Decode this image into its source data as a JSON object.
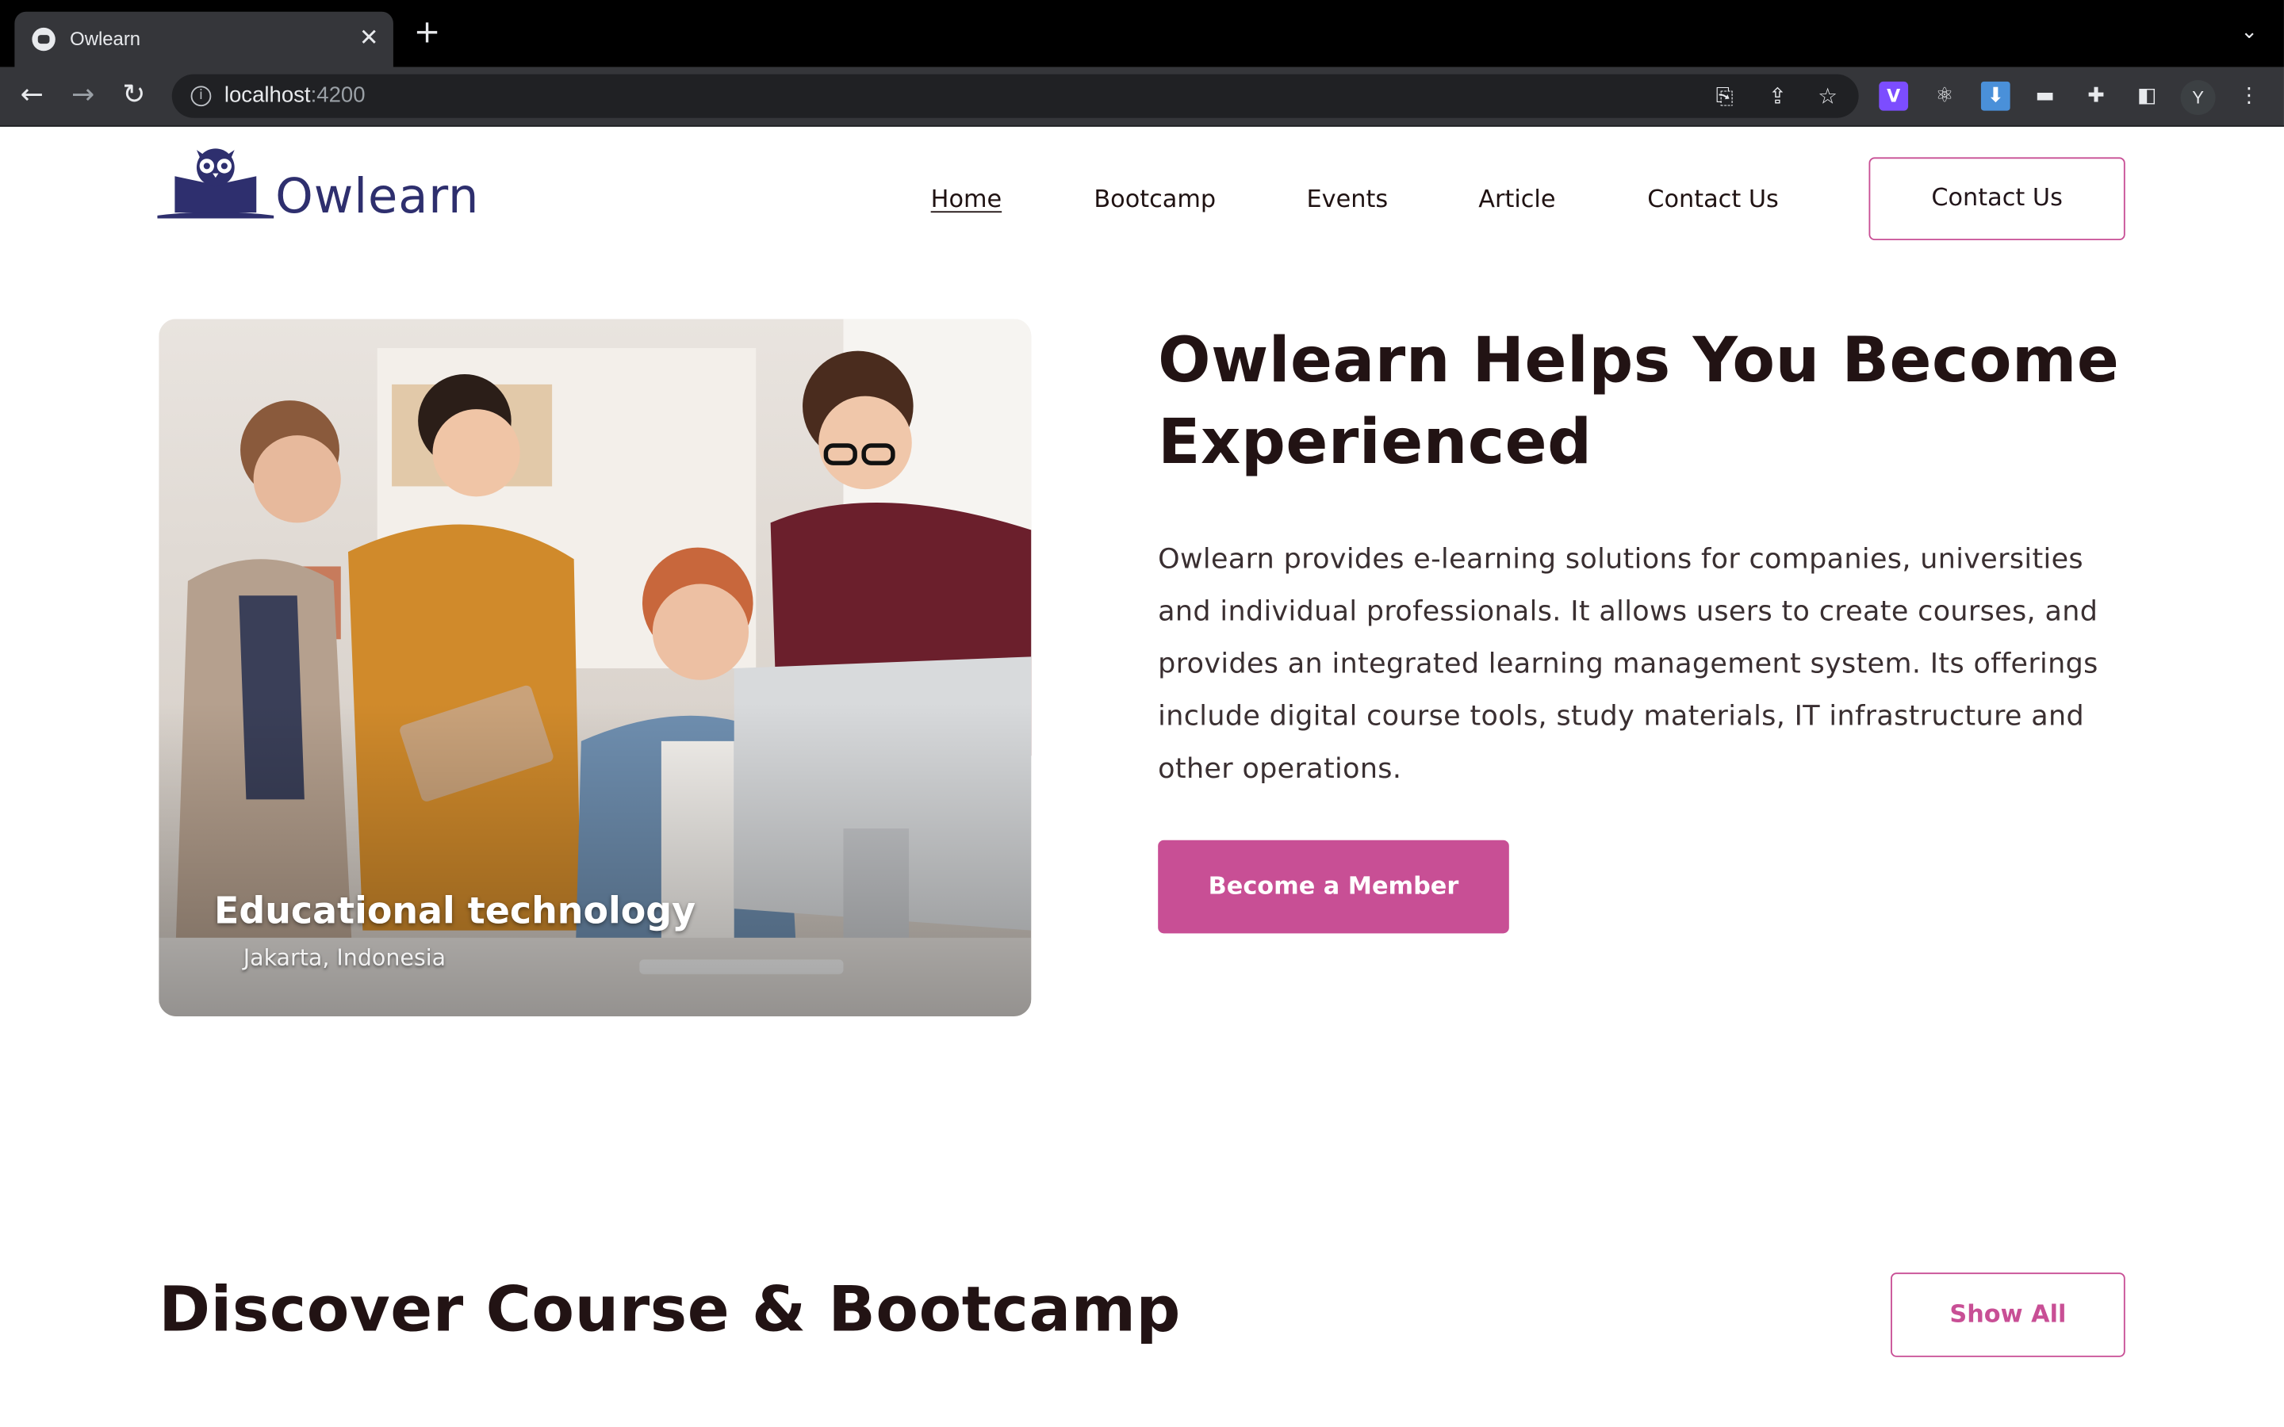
{
  "browser": {
    "tab_title": "Owlearn",
    "tab_close": "✕",
    "new_tab": "+",
    "tab_menu": "⌄",
    "url_host": "localhost",
    "url_port": ":4200",
    "info_icon_glyph": "i",
    "profile_initial": "Y",
    "icons": [
      "back-icon",
      "forward-icon",
      "reload-icon",
      "translate-icon",
      "share-icon",
      "bookmark-star-icon",
      "extension-v-icon",
      "react-devtools-icon",
      "download-icon",
      "extension-icon",
      "puzzle-icon",
      "side-panel-icon",
      "menu-dots-icon"
    ]
  },
  "site": {
    "logo_text": "Owlearn",
    "nav": {
      "home": "Home",
      "bootcamp": "Bootcamp",
      "events": "Events",
      "article": "Article",
      "contact": "Contact Us"
    },
    "cta_contact": "Contact Us"
  },
  "hero": {
    "image_caption": "Educational technology",
    "image_location": "Jakarta, Indonesia",
    "title": "Owlearn Helps You Become Experienced",
    "description": "Owlearn provides e-learning solutions for companies, universities and individual professionals. It allows users to create courses, and provides an integrated learning management system. Its offerings include digital course tools, study materials, IT infrastructure and other operations.",
    "button": "Become a Member"
  },
  "courses": {
    "title": "Discover Course & Bootcamp",
    "show_all": "Show All"
  },
  "colors": {
    "accent": "#c84f95",
    "brand": "#2e2f6e",
    "heading": "#221314"
  }
}
